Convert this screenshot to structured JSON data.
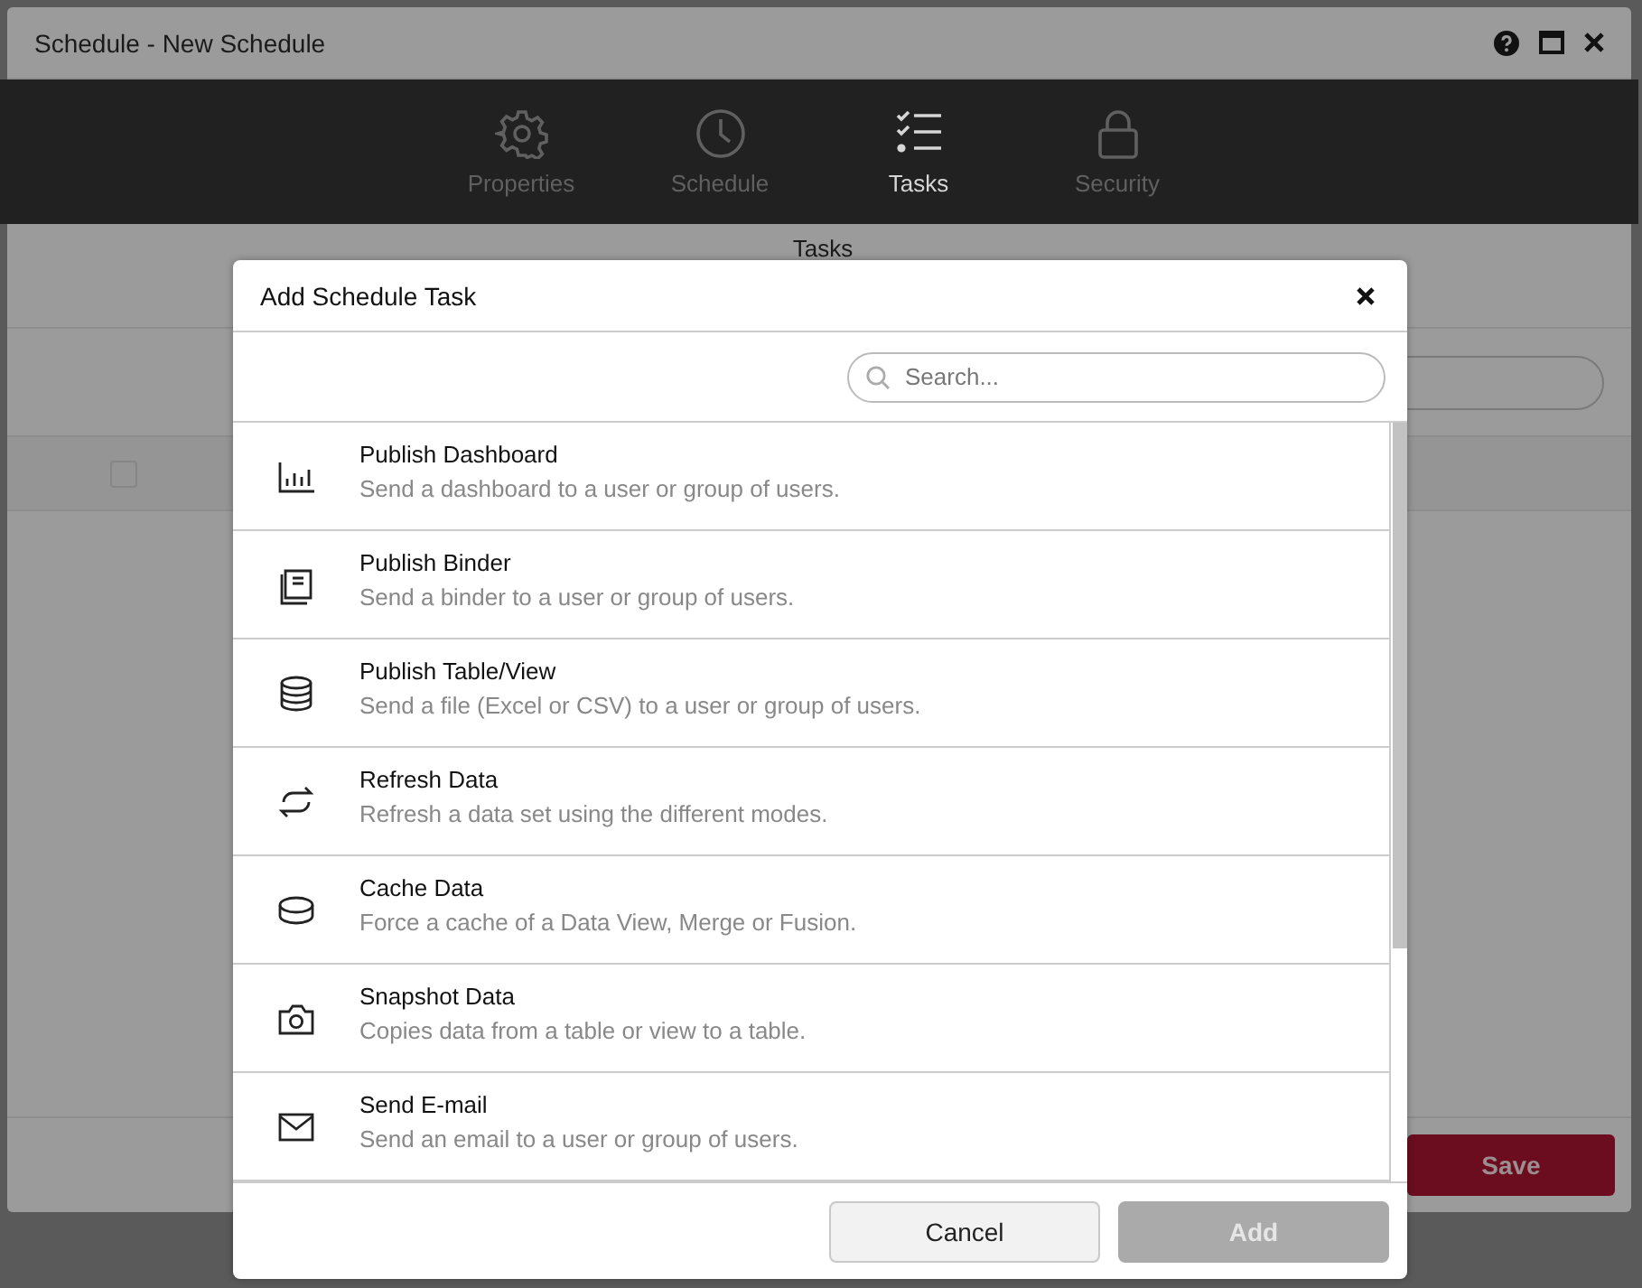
{
  "window": {
    "title": "Schedule - New Schedule"
  },
  "nav_tabs": [
    {
      "label": "Properties",
      "kind": "gear",
      "selected": false
    },
    {
      "label": "Schedule",
      "kind": "clock",
      "selected": false
    },
    {
      "label": "Tasks",
      "kind": "checklist",
      "selected": true
    },
    {
      "label": "Security",
      "kind": "lock",
      "selected": false
    }
  ],
  "background": {
    "heading": "Tasks",
    "select_all": {
      "checked": false
    },
    "save_button": "Save"
  },
  "dialog": {
    "title": "Add Schedule Task",
    "search": {
      "placeholder": "Search..."
    },
    "tasks": [
      {
        "kind": "dashboard",
        "name": "Publish Dashboard",
        "description": "Send a dashboard to a user or group of users."
      },
      {
        "kind": "binder",
        "name": "Publish Binder",
        "description": "Send a binder to a user or group of users."
      },
      {
        "kind": "table",
        "name": "Publish Table/View",
        "description": "Send a file (Excel or CSV) to a user or group of users."
      },
      {
        "kind": "refresh",
        "name": "Refresh Data",
        "description": "Refresh a data set using the different modes."
      },
      {
        "kind": "cache",
        "name": "Cache Data",
        "description": "Force a cache of a Data View, Merge or Fusion."
      },
      {
        "kind": "snapshot",
        "name": "Snapshot Data",
        "description": "Copies data from a table or view to a table."
      },
      {
        "kind": "email",
        "name": "Send E-mail",
        "description": "Send an email to a user or group of users."
      }
    ],
    "buttons": [
      {
        "label": "Cancel",
        "disabled": false
      },
      {
        "label": "Add",
        "disabled": true
      }
    ]
  }
}
